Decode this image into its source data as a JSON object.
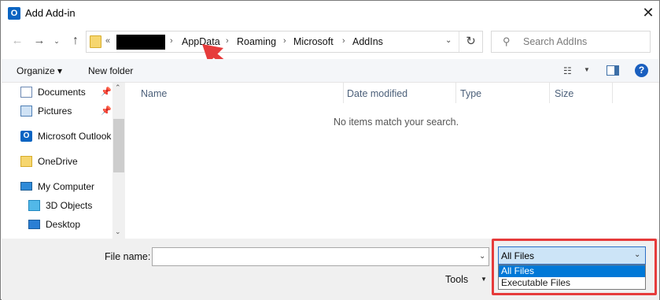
{
  "window": {
    "title": "Add Add-in",
    "app_icon_letter": "O",
    "close_glyph": "✕"
  },
  "nav": {
    "back": "←",
    "forward": "→",
    "history_dropdown": "⌄",
    "up": "↑"
  },
  "address": {
    "overflow": "«",
    "crumbs": [
      "AppData",
      "Roaming",
      "Microsoft",
      "AddIns"
    ],
    "separator": "›",
    "refresh": "↻",
    "dropdown": "⌄"
  },
  "search": {
    "placeholder": "Search AddIns",
    "icon": "⚲"
  },
  "toolbar": {
    "organize": "Organize ▾",
    "new_folder": "New folder",
    "view_icon": "☷",
    "view_dd": "▼",
    "help": "?"
  },
  "navpane": {
    "items": [
      {
        "label": "Documents",
        "icon": "documents-icon",
        "pinned": true
      },
      {
        "label": "Pictures",
        "icon": "pictures-icon",
        "pinned": true
      },
      {
        "label": "Microsoft Outlook",
        "icon": "outlook-icon",
        "pinned": false
      },
      {
        "label": "OneDrive",
        "icon": "onedrive-icon",
        "pinned": false
      },
      {
        "label": "My Computer",
        "icon": "computer-icon",
        "pinned": false
      },
      {
        "label": "3D Objects",
        "icon": "3d-objects-icon",
        "pinned": false
      },
      {
        "label": "Desktop",
        "icon": "desktop-icon",
        "pinned": false
      }
    ],
    "pin_glyph": "📌",
    "scroll_up": "⌃",
    "scroll_down": "⌄"
  },
  "filelist": {
    "columns": [
      "Name",
      "Date modified",
      "Type",
      "Size"
    ],
    "empty_message": "No items match your search."
  },
  "footer": {
    "file_name_label": "File name:",
    "file_name_value": "",
    "file_name_dd": "⌄",
    "tools": "Tools",
    "tools_dd": "▼",
    "filter": {
      "selected": "All Files",
      "dd": "⌄",
      "options": [
        "All Files",
        "Executable Files"
      ],
      "highlighted_index": 0
    }
  },
  "colors": {
    "accent": "#0078d7",
    "annotation": "#e63b3b"
  }
}
